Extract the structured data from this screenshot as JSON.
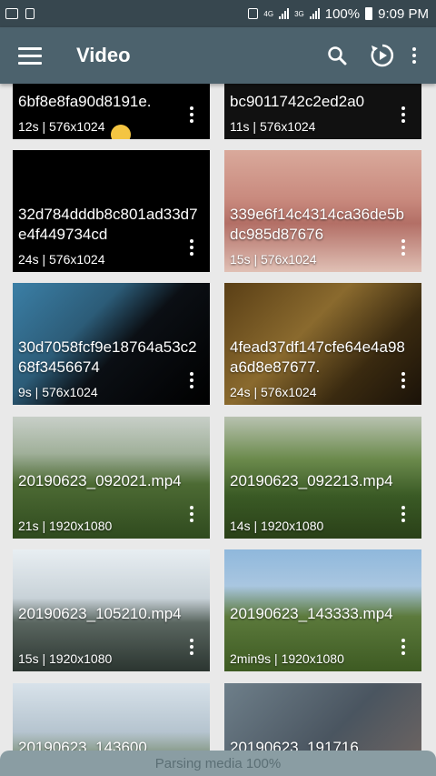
{
  "status_bar": {
    "net1": "4G",
    "net2": "3G",
    "battery": "100%",
    "time": "9:09 PM"
  },
  "app_bar": {
    "title": "Video",
    "search_icon": "search-icon",
    "refresh_icon": "refresh-play-icon",
    "menu_icon": "hamburger-menu-icon",
    "overflow_icon": "more-vert-icon"
  },
  "videos": [
    {
      "name": "6bf8e8fa90d8191e.",
      "duration": "12s",
      "resolution": "576x1024"
    },
    {
      "name": "bc9011742c2ed2a0",
      "duration": "11s",
      "resolution": "576x1024"
    },
    {
      "name": "32d784dddb8c801ad33d7e4f449734cd",
      "duration": "24s",
      "resolution": "576x1024"
    },
    {
      "name": "339e6f14c4314ca36de5bdc985d87676",
      "duration": "15s",
      "resolution": "576x1024"
    },
    {
      "name": "30d7058fcf9e18764a53c268f3456674",
      "duration": "9s",
      "resolution": "576x1024"
    },
    {
      "name": "4fead37df147cfe64e4a98a6d8e87677.",
      "duration": "24s",
      "resolution": "576x1024"
    },
    {
      "name": "20190623_092021.mp4",
      "duration": "21s",
      "resolution": "1920x1080"
    },
    {
      "name": "20190623_092213.mp4",
      "duration": "14s",
      "resolution": "1920x1080"
    },
    {
      "name": "20190623_105210.mp4",
      "duration": "15s",
      "resolution": "1920x1080"
    },
    {
      "name": "20190623_143333.mp4",
      "duration": "2min9s",
      "resolution": "1920x1080"
    },
    {
      "name": "20190623_143600",
      "duration": "",
      "resolution": ""
    },
    {
      "name": "20190623_191716",
      "duration": "",
      "resolution": ""
    }
  ],
  "footer": {
    "text": "Parsing media 100%"
  },
  "colors": {
    "status_bar": "#37474f",
    "app_bar": "#4c626d"
  }
}
